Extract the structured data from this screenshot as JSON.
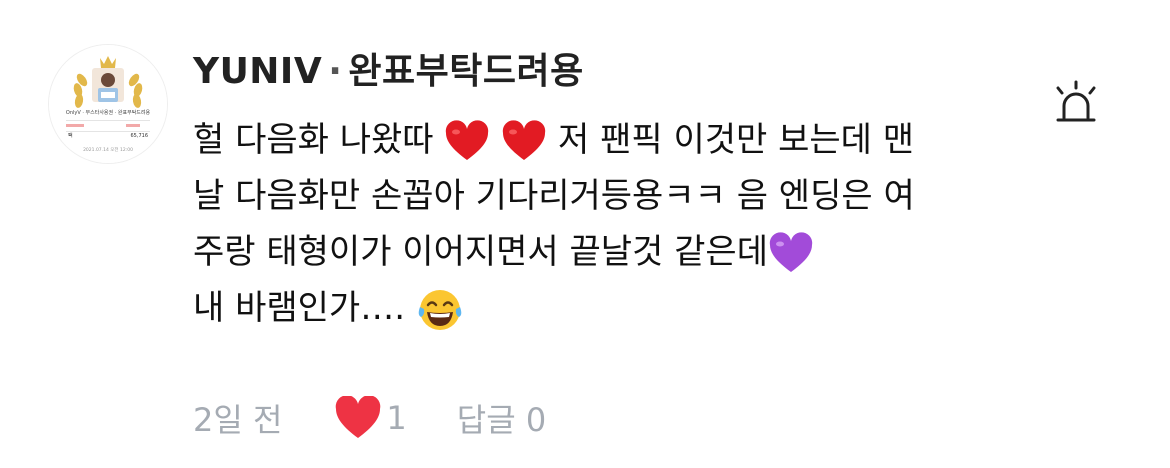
{
  "comment": {
    "author_name": "YUNIV",
    "author_separator": "·",
    "author_nickname": "완표부탁드려용",
    "avatar": {
      "title": "OnlyV · 부스타사용권 · 완표부탁드려용",
      "value": "65,716",
      "date": "2021.07.14 오전 12:00"
    },
    "text_lines": [
      {
        "before": "헐 다음화 나왔따",
        "after": " 저 팬픽 이것만 보는데 맨"
      },
      {
        "text": "날 다음화만 손꼽아 기다리거등용ㅋㅋ 음 엔딩은 여"
      },
      {
        "before": "주랑 태형이가 이어지면서 끝날것 같은데",
        "after": ""
      },
      {
        "before": "내 바램인가….",
        "after": ""
      }
    ],
    "emojis": [
      "red-heart",
      "red-heart",
      "purple-heart",
      "tears-of-joy"
    ],
    "time_ago": "2일 전",
    "like_count": "1",
    "reply_label": "답글",
    "reply_count": "0",
    "colors": {
      "like_heart": "#ee3344",
      "meta_text": "#a5abb3",
      "purple_heart": "#a24bd9"
    }
  }
}
